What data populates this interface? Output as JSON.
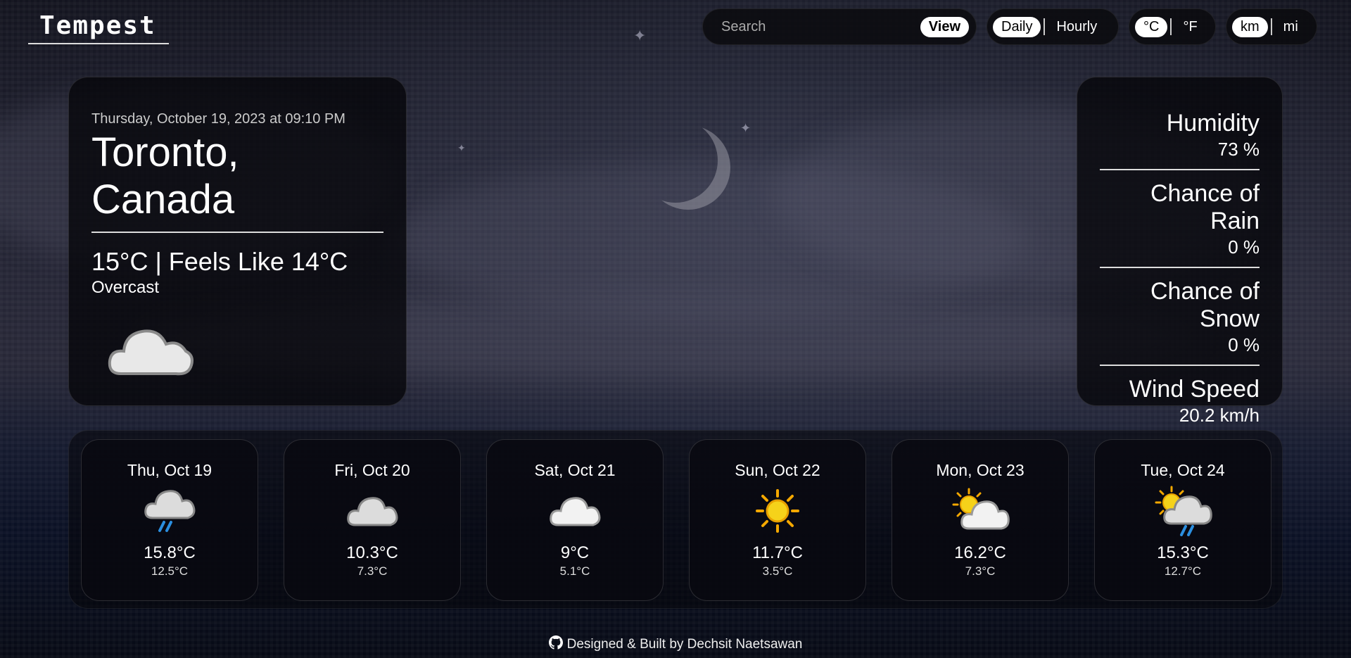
{
  "app": {
    "logo": "Tempest"
  },
  "header": {
    "search_placeholder": "Search",
    "view_label": "View",
    "mode_options": [
      "Daily",
      "Hourly"
    ],
    "mode_selected": "Daily",
    "temp_unit_options": [
      "°C",
      "°F"
    ],
    "temp_unit_selected": "°C",
    "distance_unit_options": [
      "km",
      "mi"
    ],
    "distance_unit_selected": "km"
  },
  "current": {
    "datetime": "Thursday, October 19, 2023 at 09:10 PM",
    "location": "Toronto, Canada",
    "temp_line": "15°C | Feels Like 14°C",
    "condition": "Overcast",
    "icon": "cloud-icon"
  },
  "stats": [
    {
      "label": "Humidity",
      "value": "73 %"
    },
    {
      "label": "Chance of Rain",
      "value": "0 %"
    },
    {
      "label": "Chance of Snow",
      "value": "0 %"
    },
    {
      "label": "Wind Speed",
      "value": "20.2 km/h"
    }
  ],
  "forecast": [
    {
      "day": "Thu, Oct 19",
      "high": "15.8°C",
      "low": "12.5°C",
      "icon": "rain-cloud-icon"
    },
    {
      "day": "Fri, Oct 20",
      "high": "10.3°C",
      "low": "7.3°C",
      "icon": "cloud-icon"
    },
    {
      "day": "Sat, Oct 21",
      "high": "9°C",
      "low": "5.1°C",
      "icon": "cloud-icon"
    },
    {
      "day": "Sun, Oct 22",
      "high": "11.7°C",
      "low": "3.5°C",
      "icon": "sun-icon"
    },
    {
      "day": "Mon, Oct 23",
      "high": "16.2°C",
      "low": "7.3°C",
      "icon": "partly-cloudy-icon"
    },
    {
      "day": "Tue, Oct 24",
      "high": "15.3°C",
      "low": "12.7°C",
      "icon": "partly-cloudy-rain-icon"
    }
  ],
  "footer": {
    "text": "Designed & Built by Dechsit Naetsawan",
    "icon": "github-icon"
  },
  "colors": {
    "sun": "#f5c518",
    "cloud": "#e6e6e6",
    "rain": "#2b8fe0",
    "accent": "#ffffff"
  }
}
